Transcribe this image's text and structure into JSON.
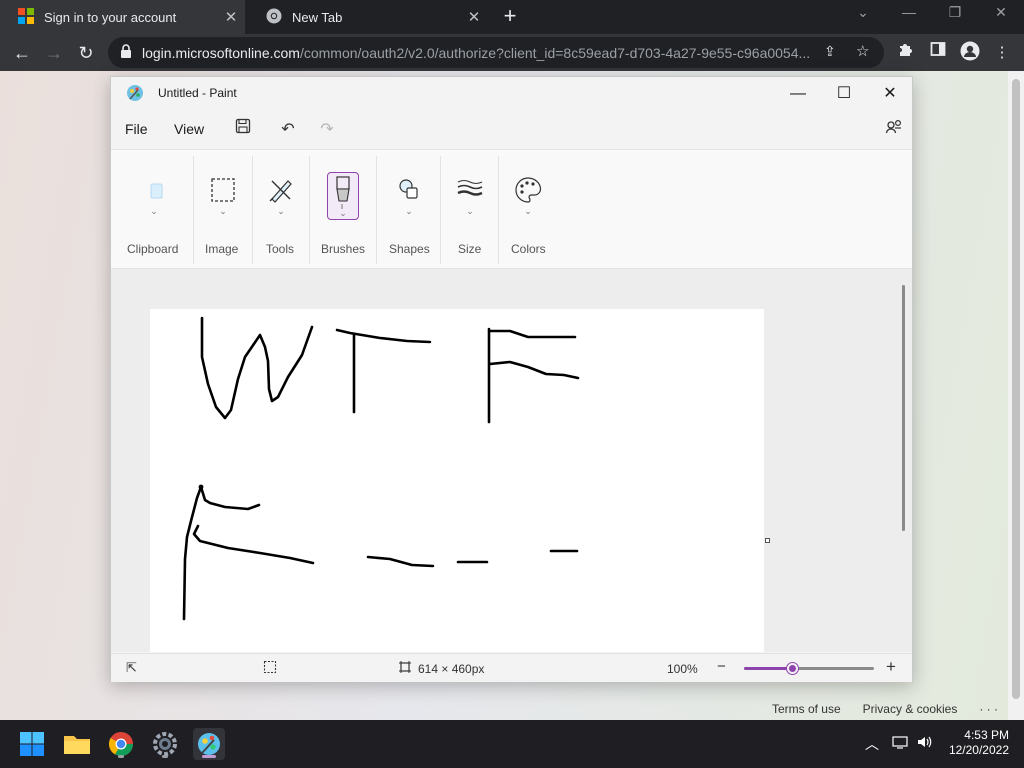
{
  "browser": {
    "tabs": [
      {
        "label": "Sign in to your account",
        "icon": "microsoft-logo",
        "active": true
      },
      {
        "label": "New Tab",
        "icon": "chrome-logo",
        "active": false
      }
    ],
    "new_tab_glyph": "+",
    "url_host": "login.microsoftonline.com",
    "url_path": "/common/oauth2/v2.0/authorize?client_id=8c59ead7-d703-4a27-9e55-c96a0054..."
  },
  "paint": {
    "title": "Untitled - Paint",
    "menu": {
      "file": "File",
      "view": "View"
    },
    "ribbon": {
      "clipboard": "Clipboard",
      "image": "Image",
      "tools": "Tools",
      "brushes": "Brushes",
      "shapes": "Shapes",
      "size": "Size",
      "colors": "Colors"
    },
    "status": {
      "canvas_size": "614 × 460px",
      "zoom": "100%",
      "zoom_fraction": 0.38
    }
  },
  "page_footer": {
    "terms": "Terms of use",
    "privacy": "Privacy & cookies",
    "more": "· · ·"
  },
  "taskbar": {
    "time": "4:53 PM",
    "date": "12/20/2022"
  },
  "colors": {
    "accent": "#8e44ad",
    "chrome_dark": "#202124",
    "chrome_toolbar": "#35363a"
  }
}
